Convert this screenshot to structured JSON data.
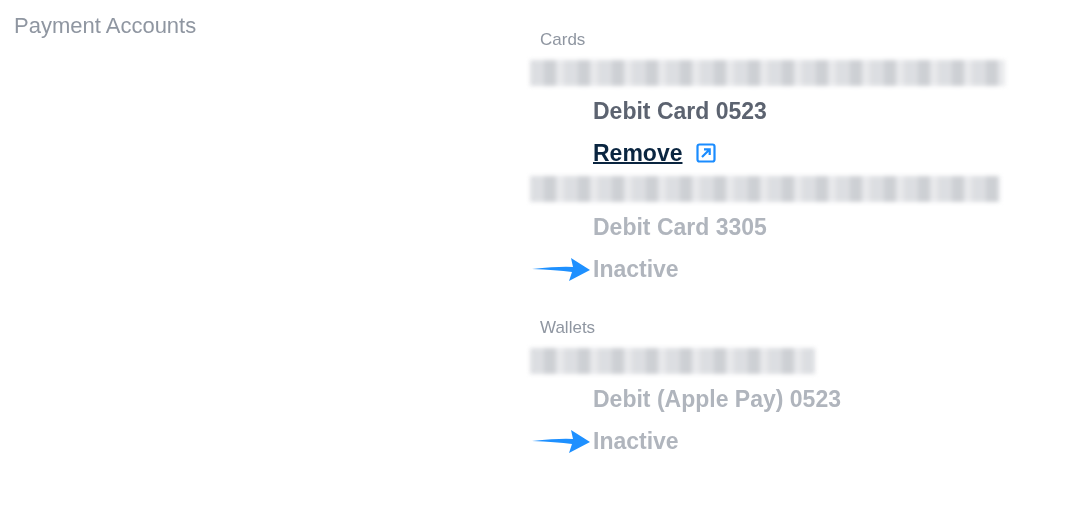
{
  "title": "Payment Accounts",
  "sections": [
    {
      "label": "Cards",
      "accounts": [
        {
          "redacted": true,
          "name": "Debit Card 0523",
          "active": true,
          "action": {
            "label": "Remove",
            "external": true
          }
        },
        {
          "redacted": true,
          "name": "Debit Card 3305",
          "active": false,
          "status": "Inactive",
          "arrow": true
        }
      ]
    },
    {
      "label": "Wallets",
      "accounts": [
        {
          "redacted": true,
          "name": "Debit (Apple Pay) 0523",
          "active": false,
          "status": "Inactive",
          "arrow": true
        }
      ]
    }
  ]
}
